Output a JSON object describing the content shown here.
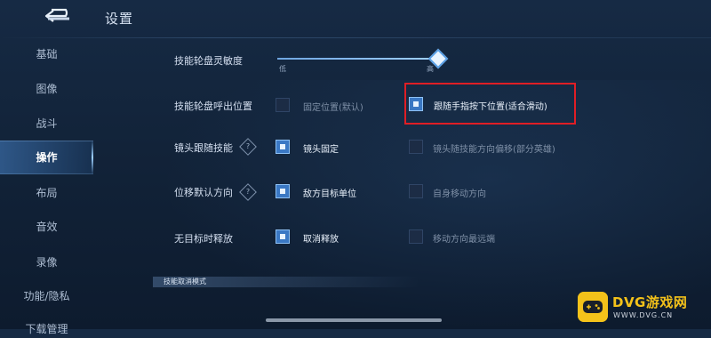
{
  "header": {
    "title": "设置"
  },
  "sidebar": {
    "items": [
      {
        "label": "基础"
      },
      {
        "label": "图像"
      },
      {
        "label": "战斗"
      },
      {
        "label": "操作",
        "active": true
      },
      {
        "label": "布局"
      },
      {
        "label": "音效"
      },
      {
        "label": "录像"
      },
      {
        "label": "功能/隐私"
      },
      {
        "label": "下载管理"
      }
    ]
  },
  "settings": {
    "sensitivity": {
      "label": "技能轮盘灵敏度",
      "min_label": "低",
      "max_label": "高",
      "value": 1.0
    },
    "wheel_position": {
      "label": "技能轮盘呼出位置",
      "options": [
        {
          "label": "固定位置(默认)",
          "checked": false
        },
        {
          "label": "跟随手指按下位置(适合滑动)",
          "checked": true
        }
      ]
    },
    "camera_follow": {
      "label": "镜头跟随技能",
      "options": [
        {
          "label": "镜头固定",
          "checked": true
        },
        {
          "label": "镜头随技能方向偏移(部分英雄)",
          "checked": false
        }
      ]
    },
    "move_default": {
      "label": "位移默认方向",
      "options": [
        {
          "label": "敌方目标单位",
          "checked": true
        },
        {
          "label": "自身移动方向",
          "checked": false
        }
      ]
    },
    "no_target_release": {
      "label": "无目标时释放",
      "options": [
        {
          "label": "取消释放",
          "checked": true
        },
        {
          "label": "移动方向最远端",
          "checked": false
        }
      ]
    },
    "section": {
      "label": "技能取消模式"
    }
  },
  "watermark": {
    "brand": "DVG游戏网",
    "url": "WWW.DVG.CN"
  },
  "colors": {
    "accent": "#3a78c4",
    "highlight": "#e01e25",
    "watermark": "#f4c21a"
  }
}
